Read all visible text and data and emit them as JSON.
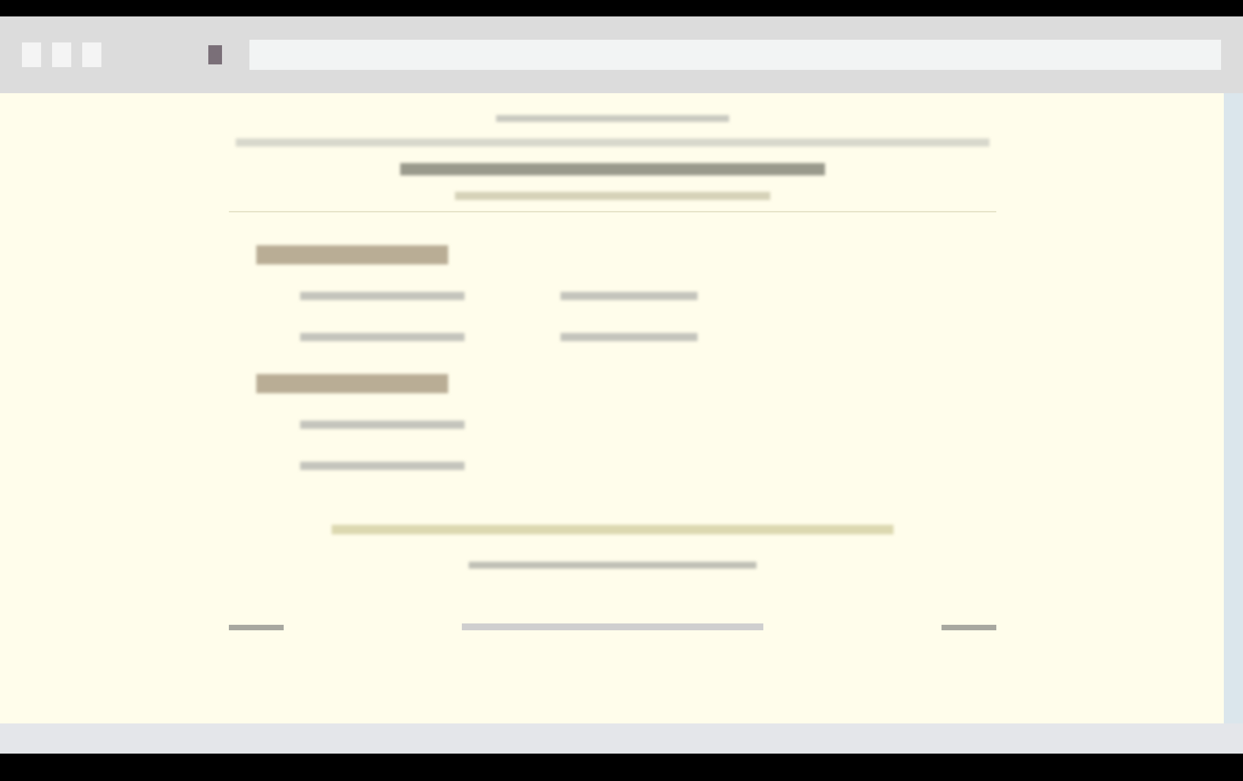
{
  "browser": {
    "toolbar_buttons": [
      {
        "kind": "nav"
      },
      {
        "kind": "nav"
      },
      {
        "kind": "nav"
      },
      {
        "kind": "tool"
      }
    ]
  },
  "header_lines": [
    {
      "kind": "small"
    },
    {
      "kind": "wide"
    },
    {
      "kind": "title"
    },
    {
      "kind": "subtitle"
    }
  ],
  "sections": [
    {
      "heading": {
        "kind": "heading"
      },
      "columns": [
        [
          {
            "kind": "link"
          },
          {
            "kind": "link"
          }
        ],
        [
          {
            "kind": "link-short"
          },
          {
            "kind": "link-short"
          }
        ]
      ]
    },
    {
      "heading": {
        "kind": "heading"
      },
      "columns": [
        [
          {
            "kind": "link"
          },
          {
            "kind": "link"
          }
        ]
      ]
    }
  ],
  "footer_lines": [
    {
      "kind": "note"
    },
    {
      "kind": "link-center"
    }
  ],
  "bottom_nav": [
    {
      "kind": "side"
    },
    {
      "kind": "center"
    },
    {
      "kind": "side"
    }
  ]
}
